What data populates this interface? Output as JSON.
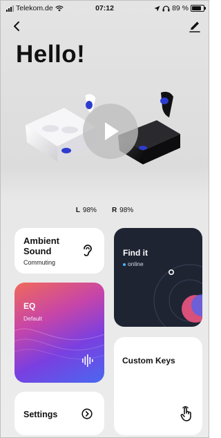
{
  "status_bar": {
    "carrier": "Telekom.de",
    "time": "07:12",
    "battery": "89 %"
  },
  "topbar": {
    "back_icon": "chevron-left-icon",
    "edit_icon": "pencil-icon"
  },
  "greeting": "Hello!",
  "media": {
    "play_icon": "play-icon"
  },
  "battery_levels": {
    "left_label": "L",
    "left_value": "98%",
    "right_label": "R",
    "right_value": "98%"
  },
  "cards": {
    "ambient": {
      "title": "Ambient Sound",
      "subtitle": "Commuting",
      "icon": "ear-icon"
    },
    "find_it": {
      "title": "Find it",
      "status": "online",
      "accent": "#4fb6ff"
    },
    "eq": {
      "title": "EQ",
      "subtitle": "Default",
      "icon": "equalizer-bars-icon"
    },
    "custom_keys": {
      "title": "Custom Keys",
      "icon": "touch-hand-icon"
    },
    "settings": {
      "title": "Settings",
      "icon": "arrow-circle-icon"
    }
  },
  "colors": {
    "eq_gradient": [
      "#f06a5a",
      "#c745a8",
      "#7a3fe0",
      "#4a68f0"
    ],
    "find_bg": "#1f2433",
    "earbud_accent": "#2d3ccf"
  }
}
